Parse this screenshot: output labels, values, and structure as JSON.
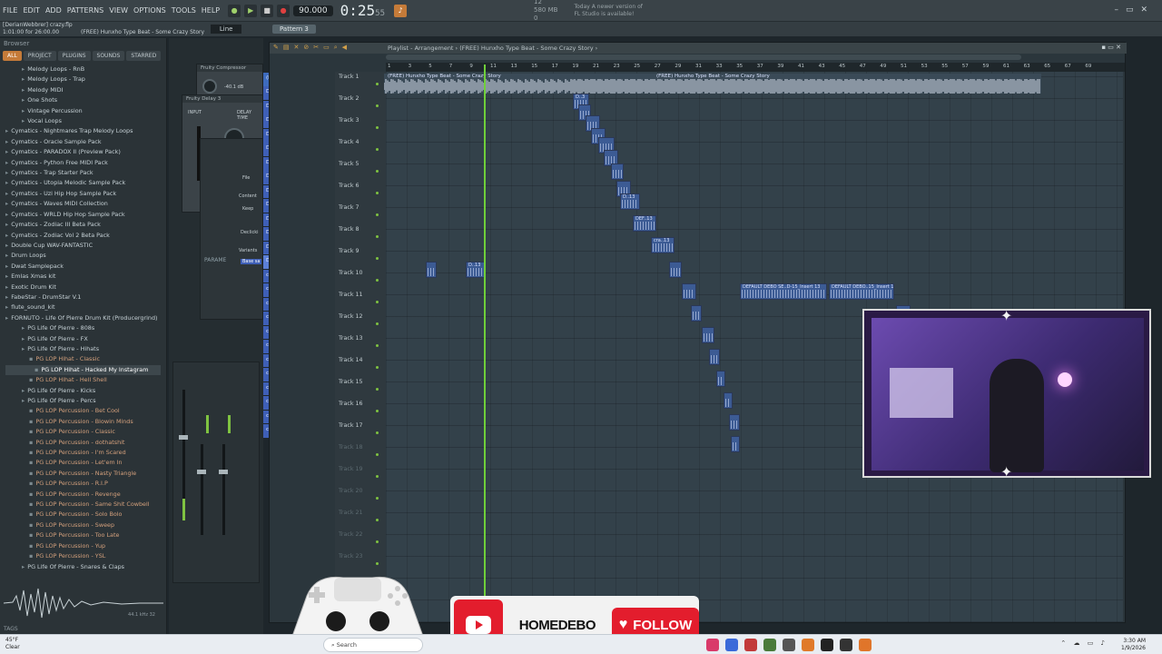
{
  "menu": [
    "FILE",
    "EDIT",
    "ADD",
    "PATTERNS",
    "VIEW",
    "OPTIONS",
    "TOOLS",
    "HELP"
  ],
  "transport": {
    "tempo": "90.000",
    "timecode": "0:25",
    "timecode_sub": "55",
    "cpu_line1": "12",
    "cpu_line2": "580 MB",
    "cpu_line3": "0"
  },
  "project": {
    "user": "[DerianWebbrer]",
    "file": "crazy.flp",
    "time": "1:01:00 for 26:00.00",
    "title": "(FREE) Hunxho Type Beat - Some Crazy Story"
  },
  "news": {
    "line1": "Today  A newer version of",
    "line2": "FL Studio is available!"
  },
  "toolbar": {
    "pattern": "Pattern 3",
    "line": "Line"
  },
  "browser": {
    "title": "Browser",
    "tabs": [
      "ALL",
      "PROJECT",
      "PLUGINS",
      "SOUNDS",
      "STARRED"
    ],
    "items": [
      {
        "t": "Melody Loops - RnB",
        "c": "lvl1"
      },
      {
        "t": "Melody Loops - Trap",
        "c": "lvl1"
      },
      {
        "t": "Melody MIDI",
        "c": "lvl1"
      },
      {
        "t": "One Shots",
        "c": "lvl1"
      },
      {
        "t": "Vintage Percussion",
        "c": "lvl1"
      },
      {
        "t": "Vocal Loops",
        "c": "lvl1"
      },
      {
        "t": "Cymatics - Nightmares Trap Melody Loops",
        "c": ""
      },
      {
        "t": "Cymatics - Oracle Sample Pack",
        "c": ""
      },
      {
        "t": "Cymatics - PARADOX II (Preview Pack)",
        "c": ""
      },
      {
        "t": "Cymatics - Python Free MIDI Pack",
        "c": ""
      },
      {
        "t": "Cymatics - Trap Starter Pack",
        "c": ""
      },
      {
        "t": "Cymatics - Utopia Melodic Sample Pack",
        "c": ""
      },
      {
        "t": "Cymatics - Uzi Hip Hop Sample Pack",
        "c": ""
      },
      {
        "t": "Cymatics - Waves MIDI Collection",
        "c": ""
      },
      {
        "t": "Cymatics - WRLD Hip Hop Sample Pack",
        "c": ""
      },
      {
        "t": "Cymatics - Zodiac III Beta Pack",
        "c": ""
      },
      {
        "t": "Cymatics - Zodiac Vol 2 Beta Pack",
        "c": ""
      },
      {
        "t": "Double Cup WAV-FANTASTIC",
        "c": ""
      },
      {
        "t": "Drum Loops",
        "c": ""
      },
      {
        "t": "Dwat Samplepack",
        "c": ""
      },
      {
        "t": "Emlas Xmas kit",
        "c": ""
      },
      {
        "t": "Exotic Drum Kit",
        "c": ""
      },
      {
        "t": "FabeStar - DrumStar V.1",
        "c": ""
      },
      {
        "t": "flute_sound_kit",
        "c": ""
      },
      {
        "t": "FORNUTO - Life Of Pierre Drum Kit (Producergrind)",
        "c": ""
      },
      {
        "t": "PG Life Of Pierre - 808s",
        "c": "lvl1"
      },
      {
        "t": "PG Life Of Pierre - FX",
        "c": "lvl1"
      },
      {
        "t": "PG Life Of Pierre - Hihats",
        "c": "lvl1"
      },
      {
        "t": "PG LOP Hihat - Classic",
        "c": "lvl2"
      },
      {
        "t": "PG LOP Hihat - Hacked My Instagram",
        "c": "lvl3 sel"
      },
      {
        "t": "PG LOP Hihat - Hell Shell",
        "c": "lvl2"
      },
      {
        "t": "PG Life Of Pierre - Kicks",
        "c": "lvl1"
      },
      {
        "t": "PG Life Of Pierre - Percs",
        "c": "lvl1"
      },
      {
        "t": "PG LOP Percussion - Bet Cool",
        "c": "lvl2"
      },
      {
        "t": "PG LOP Percussion - Blowin Minds",
        "c": "lvl2"
      },
      {
        "t": "PG LOP Percussion - Classic",
        "c": "lvl2"
      },
      {
        "t": "PG LOP Percussion - dothatshit",
        "c": "lvl2"
      },
      {
        "t": "PG LOP Percussion - I'm Scared",
        "c": "lvl2"
      },
      {
        "t": "PG LOP Percussion - Let'em In",
        "c": "lvl2"
      },
      {
        "t": "PG LOP Percussion - Nasty Triangle",
        "c": "lvl2"
      },
      {
        "t": "PG LOP Percussion - R.I.P",
        "c": "lvl2"
      },
      {
        "t": "PG LOP Percussion - Revenge",
        "c": "lvl2"
      },
      {
        "t": "PG LOP Percussion - Same Shit Cowbell",
        "c": "lvl2"
      },
      {
        "t": "PG LOP Percussion - Solo Bolo",
        "c": "lvl2"
      },
      {
        "t": "PG LOP Percussion - Sweep",
        "c": "lvl2"
      },
      {
        "t": "PG LOP Percussion - Too Late",
        "c": "lvl2"
      },
      {
        "t": "PG LOP Percussion - Yup",
        "c": "lvl2"
      },
      {
        "t": "PG LOP Percussion - YSL",
        "c": "lvl2"
      },
      {
        "t": "PG Life Of Pierre - Snares & Claps",
        "c": "lvl1"
      },
      {
        "t": "PG Life Of Pierre - Vox",
        "c": "lvl1"
      }
    ],
    "tags": "TAGS",
    "rate": "44.1 kHz 32"
  },
  "plugins": {
    "compressor": "Fruity Compressor",
    "delay": "Fruity Delay 3",
    "threshold": "THRESHOLD",
    "input": "INPUT",
    "delay_time": "DELAY TIME",
    "thr_val": "-40.1 dB",
    "param": "PARAME",
    "tool_labels": [
      "File",
      "Content",
      "Keep",
      "Declicki",
      "Variants",
      "Base sa"
    ]
  },
  "clips_list": [
    "(FREE) Hunxho Type..",
    "DEFAULT DEBO SETUP_202..",
    "DEFAULT DEBO SETUP_202..",
    "DEFAULT DEBO SETUP_202..",
    "DEFAULT DEBO SETUP_202..",
    "DEFAULT DEBO SETUP_202..",
    "DEFAULT DEBO SETUP_202..",
    "DEFAULT DEBO SETUP_202..",
    "DEFAULT DEBO SETUP_202..",
    "DEFAULT DEBO SETUP_202..",
    "DEFAULT DEBO SETUP_202..",
    "DEFAULT DEBO SETUP_202..",
    "DEFAULT DEBO SETUP_202..",
    "DEFAULT DEBO SETUP_202..",
    "crazy_2026-01-09 03-06..",
    "crazy_2026-01-09 03-07..",
    "crazy_2026-01-09 03-07..",
    "crazy_2026-01-09 03-08..",
    "crazy_2026-01-09 03-08..",
    "crazy_2026-01-09 03-09..",
    "crazy_2026-01-09 03-09..",
    "crazy_2026-01-09 03-10..",
    "crazy_2026-01-09 03-11..",
    "crazy_2026-01-09 03-12..",
    "crazy_2026-01-09 03-12..",
    "crazy_2026-01-09 03-13.."
  ],
  "playlist": {
    "title": "Playlist - Arrangement  › (FREE) Hunxho Type Beat - Some Crazy Story ›",
    "ruler": [
      "1",
      "3",
      "5",
      "7",
      "9",
      "11",
      "13",
      "15",
      "17",
      "19",
      "21",
      "23",
      "25",
      "27",
      "29",
      "31",
      "33",
      "35",
      "37",
      "39",
      "41",
      "43",
      "45",
      "47",
      "49",
      "51",
      "53",
      "55",
      "57",
      "59",
      "61",
      "63",
      "65",
      "67",
      "69"
    ],
    "tracks": [
      "Track 1",
      "Track 2",
      "Track 3",
      "Track 4",
      "Track 5",
      "Track 6",
      "Track 7",
      "Track 8",
      "Track 9",
      "Track 10",
      "Track 11",
      "Track 12",
      "Track 13",
      "Track 14",
      "Track 15",
      "Track 16",
      "Track 17",
      "Track 18",
      "Track 19",
      "Track 20",
      "Track 21",
      "Track 22",
      "Track 23"
    ],
    "audio_label": "(FREE) Hunxho Type Beat - Some Crazy Story",
    "audio_label2": "(FREE) Hunxho Type Beat - Some Crazy Story",
    "clip_labels": {
      "t3": "D..3",
      "t7": "D..13",
      "t8": "DEF..13",
      "t9": "cra..13",
      "t9b": "D..13",
      "t10a": "DEFAULT DEBO SE..D-15_Insert 13",
      "t10b": "DEFAULT DEBO..15_Insert 13"
    }
  },
  "overlay": {
    "channel": "HOMEDEBO",
    "follow": "FOLLOW"
  },
  "taskbar": {
    "temp": "45°F",
    "cond": "Clear",
    "search": "Search",
    "time": "3:30 AM",
    "date": "1/9/2026"
  }
}
